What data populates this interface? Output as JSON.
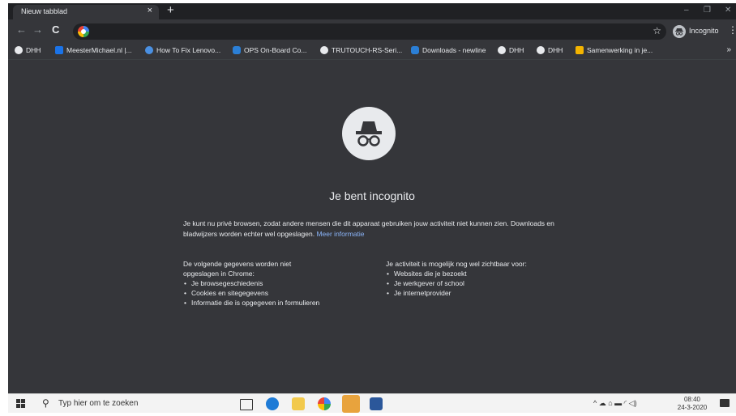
{
  "tab": {
    "title": "Nieuw tabblad",
    "close": "×",
    "new": "+"
  },
  "window": {
    "minimize": "–",
    "restore": "❐",
    "close": "✕"
  },
  "toolbar": {
    "back": "←",
    "forward": "→",
    "reload": "C",
    "omnibox_value": "",
    "star": "☆",
    "profile_label": "Incognito",
    "menu": "⋮"
  },
  "bookmarks": {
    "items": [
      {
        "label": "DHH",
        "icon": "globe-icon"
      },
      {
        "label": "MeesterMichael.nl |...",
        "icon": "site-icon"
      },
      {
        "label": "How To Fix Lenovo...",
        "icon": "site-icon"
      },
      {
        "label": "OPS On-Board Co...",
        "icon": "newline-icon"
      },
      {
        "label": "TRUTOUCH-RS-Seri...",
        "icon": "globe-icon"
      },
      {
        "label": "Downloads - newline",
        "icon": "newline-icon"
      },
      {
        "label": "DHH",
        "icon": "globe-icon"
      },
      {
        "label": "DHH",
        "icon": "globe-icon"
      },
      {
        "label": "Samenwerking in je...",
        "icon": "site-icon"
      }
    ],
    "more": "»"
  },
  "main": {
    "heading": "Je bent incognito",
    "intro": "Je kunt nu privé browsen, zodat andere mensen die dit apparaat gebruiken jouw activiteit niet kunnen zien. Downloads en bladwijzers worden echter wel opgeslagen.",
    "more_link": "Meer informatie",
    "left_title": "De volgende gegevens worden niet opgeslagen in Chrome:",
    "left_items": [
      "Je browsegeschiedenis",
      "Cookies en sitegegevens",
      "Informatie die is opgegeven in formulieren"
    ],
    "right_title": "Je activiteit is mogelijk nog wel zichtbaar voor:",
    "right_items": [
      "Websites die je bezoekt",
      "Je werkgever of school",
      "Je internetprovider"
    ]
  },
  "taskbar": {
    "search_placeholder": "Typ hier om te zoeken",
    "tray": "^ ☁ ⌂ ▬ ◜ ◁)",
    "time": "08:40",
    "date": "24-3-2020"
  },
  "colors": {
    "accent": "#8ab4f8",
    "background": "#35363a",
    "frame": "#202124"
  }
}
